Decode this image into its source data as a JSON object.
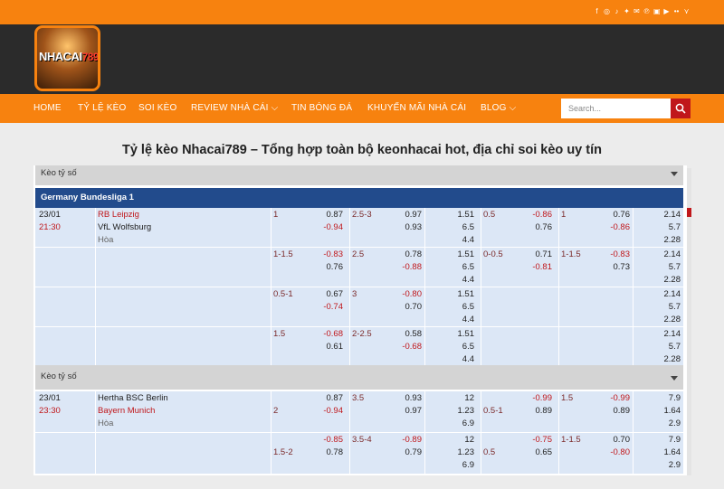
{
  "social_icons": [
    "facebook-icon",
    "instagram-icon",
    "tiktok-icon",
    "twitter-icon",
    "email-icon",
    "pinterest-icon",
    "linkedin-icon",
    "youtube-icon",
    "flickr-icon",
    "vk-icon"
  ],
  "logo": {
    "text": "NHACAI",
    "num": "789"
  },
  "nav": [
    "HOME",
    "TỶ LỆ KÈO",
    "SOI KÈO",
    "REVIEW NHÀ CÁI",
    "TIN BÓNG ĐÁ",
    "KHUYẾN MÃI NHÀ CÁI",
    "BLOG"
  ],
  "search": {
    "placeholder": "Search..."
  },
  "page_title": "Tỷ lệ kèo Nhacai789 – Tổng hợp toàn bộ keonhacai hot, địa chỉ soi kèo uy tín",
  "dropdown_top": "Kèo tỷ số",
  "league": "Germany Bundesliga 1",
  "matches": [
    {
      "date": "23/01",
      "time": "21:30",
      "home": "RB Leipzig",
      "away": "VfL Wolfsburg",
      "draw": "Hòa",
      "rows": [
        {
          "h1": "1",
          "h1a": "0.87",
          "h1b": "-0.94",
          "ou1": "2.5-3",
          "ou1a": "0.97",
          "ou1b": "0.93",
          "x1": "1.51",
          "x2": "6.5",
          "x3": "4.4",
          "h2": "0.5",
          "h2a": "-0.86",
          "h2b": "0.76",
          "ou2": "1",
          "ou2a": "0.76",
          "ou2b": "-0.86",
          "y1": "2.14",
          "y2": "5.7",
          "y3": "2.28"
        },
        {
          "h1": "1-1.5",
          "h1a": "-0.83",
          "h1b": "0.76",
          "ou1": "2.5",
          "ou1a": "0.78",
          "ou1b": "-0.88",
          "x1": "1.51",
          "x2": "6.5",
          "x3": "4.4",
          "h2": "0-0.5",
          "h2a": "0.71",
          "h2b": "-0.81",
          "ou2": "1-1.5",
          "ou2a": "-0.83",
          "ou2b": "0.73",
          "y1": "2.14",
          "y2": "5.7",
          "y3": "2.28"
        },
        {
          "h1": "0.5-1",
          "h1a": "0.67",
          "h1b": "-0.74",
          "ou1": "3",
          "ou1a": "-0.80",
          "ou1b": "0.70",
          "x1": "1.51",
          "x2": "6.5",
          "x3": "4.4",
          "h2": "",
          "h2a": "",
          "h2b": "",
          "ou2": "",
          "ou2a": "",
          "ou2b": "",
          "y1": "2.14",
          "y2": "5.7",
          "y3": "2.28"
        },
        {
          "h1": "1.5",
          "h1a": "-0.68",
          "h1b": "0.61",
          "ou1": "2-2.5",
          "ou1a": "0.58",
          "ou1b": "-0.68",
          "x1": "1.51",
          "x2": "6.5",
          "x3": "4.4",
          "h2": "",
          "h2a": "",
          "h2b": "",
          "ou2": "",
          "ou2a": "",
          "ou2b": "",
          "y1": "2.14",
          "y2": "5.7",
          "y3": "2.28"
        }
      ]
    },
    {
      "date": "23/01",
      "time": "23:30",
      "home": "Hertha BSC Berlin",
      "away": "Bayern Munich",
      "draw": "Hòa",
      "rows": [
        {
          "h1": "2",
          "h1a": "0.87",
          "h1b": "-0.94",
          "ou1": "3.5",
          "ou1a": "0.93",
          "ou1b": "0.97",
          "x1": "12",
          "x2": "1.23",
          "x3": "6.9",
          "h2": "0.5-1",
          "h2a": "-0.99",
          "h2b": "0.89",
          "ou2": "1.5",
          "ou2a": "-0.99",
          "ou2b": "0.89",
          "y1": "7.9",
          "y2": "1.64",
          "y3": "2.9"
        },
        {
          "h1": "1.5-2",
          "h1a": "-0.85",
          "h1b": "0.78",
          "ou1": "3.5-4",
          "ou1a": "-0.89",
          "ou1b": "0.79",
          "x1": "12",
          "x2": "1.23",
          "x3": "6.9",
          "h2": "0.5",
          "h2a": "-0.75",
          "h2b": "0.65",
          "ou2": "1-1.5",
          "ou2a": "0.70",
          "ou2b": "-0.80",
          "y1": "7.9",
          "y2": "1.64",
          "y3": "2.9"
        }
      ]
    }
  ],
  "dropdown_mid": "Kèo tỷ số"
}
